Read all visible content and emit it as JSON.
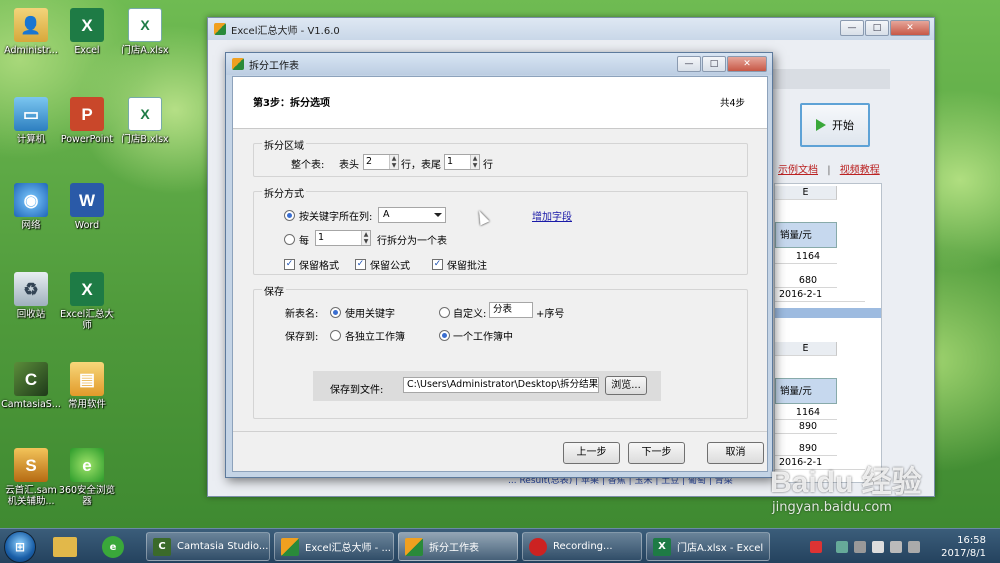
{
  "desktop_icons": [
    {
      "label": "Administr...",
      "icon": "user-folder-icon"
    },
    {
      "label": "Excel",
      "icon": "excel-icon"
    },
    {
      "label": "门店A.xlsx",
      "icon": "xlsx-file-icon"
    },
    {
      "label": "计算机",
      "icon": "computer-icon"
    },
    {
      "label": "PowerPoint",
      "icon": "powerpoint-icon"
    },
    {
      "label": "门店B.xlsx",
      "icon": "xlsx-file-icon"
    },
    {
      "label": "网络",
      "icon": "network-icon"
    },
    {
      "label": "Word",
      "icon": "word-icon"
    },
    {
      "label": "回收站",
      "icon": "recycle-bin-icon"
    },
    {
      "label": "Excel汇总大师",
      "icon": "excel-icon"
    },
    {
      "label": "CamtasiaS...",
      "icon": "camtasia-icon"
    },
    {
      "label": "常用软件",
      "icon": "folder-icon"
    },
    {
      "label": "云首汇.sam 机关辅助...",
      "icon": "app-icon"
    },
    {
      "label": "360安全浏览器",
      "icon": "browser-icon"
    }
  ],
  "back_window": {
    "title": "Excel汇总大师 - V1.6.0",
    "start_label": "开始",
    "link_example": "示例文档",
    "link_separator": "|",
    "link_video": "视频教程",
    "sheet": {
      "col_header": "E",
      "header": "销量/元",
      "values_top": [
        "1164",
        "680"
      ],
      "date_top": "2016-2-1",
      "col_header2": "E",
      "header2": "销量/元",
      "values_bottom": [
        "1164",
        "890",
        "890"
      ],
      "date_bottom": "2016-2-1"
    },
    "status_text": "... Result(总表) | 苹果 | 香蕉 | 玉米 | 土豆 | 葡萄 | 青菜"
  },
  "dialog": {
    "title": "拆分工作表",
    "step_title": "第3步：拆分选项",
    "step_total": "共4步",
    "group_region": {
      "label": "拆分区域",
      "whole_table": "整个表:",
      "header_label": "表头",
      "header_value": "2",
      "row_unit_1": "行，表尾",
      "footer_value": "1",
      "row_unit_2": "行"
    },
    "group_method": {
      "label": "拆分方式",
      "by_keyword_label": "按关键字所在列:",
      "by_keyword_selected": true,
      "keyword_column": "A",
      "add_field_link": "增加字段",
      "every_label": "每",
      "every_value": "1",
      "every_suffix": "行拆分为一个表",
      "keep_format": "保留格式",
      "keep_formula": "保留公式",
      "keep_comment": "保留批注",
      "check_mark": "✓"
    },
    "group_save": {
      "label": "保存",
      "new_name_label": "新表名:",
      "use_keyword": "使用关键字",
      "custom_label": "自定义:",
      "custom_value": "分表",
      "custom_suffix": "+序号",
      "save_to_label": "保存到:",
      "independent": "各独立工作簿",
      "single_workbook": "一个工作簿中",
      "save_file_label": "保存到文件:",
      "save_file_path": "C:\\Users\\Administrator\\Desktop\\拆分结果.xlsx",
      "browse": "浏览..."
    },
    "buttons": {
      "prev": "上一步",
      "next": "下一步",
      "cancel": "取消"
    }
  },
  "watermark": {
    "logo": "Baidu 经验",
    "url": "jingyan.baidu.com"
  },
  "taskbar": {
    "items": [
      {
        "label": "Camtasia Studio...",
        "icon": "camtasia-icon"
      },
      {
        "label": "Excel汇总大师 - ...",
        "icon": "app-icon"
      },
      {
        "label": "拆分工作表",
        "icon": "app-icon"
      },
      {
        "label": "Recording...",
        "icon": "record-icon"
      },
      {
        "label": "门店A.xlsx - Excel",
        "icon": "excel-icon"
      }
    ],
    "time": "16:58",
    "date": "2017/8/1"
  }
}
